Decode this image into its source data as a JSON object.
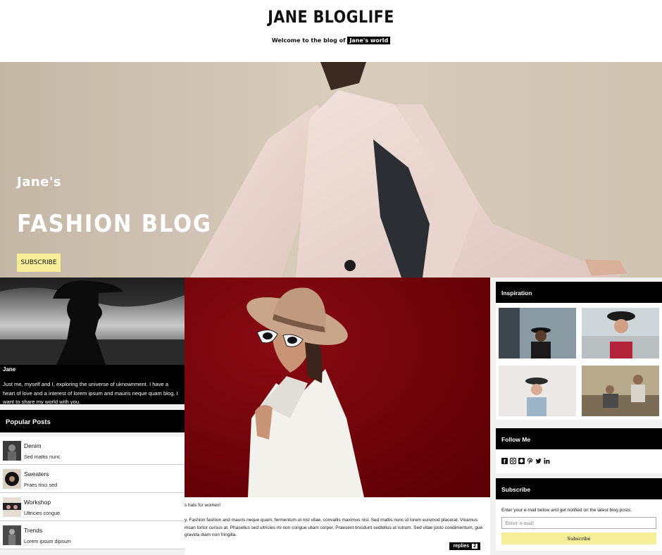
{
  "header": {
    "title": "JANE BLOGLIFE",
    "tagline_prefix": "Welcome to the blog of",
    "tagline_highlight": "Jane's world"
  },
  "hero": {
    "eyebrow": "Jane's",
    "title": "FASHION BLOG",
    "button_label": "SUBSCRIBE",
    "button_color": "#f7ee99"
  },
  "about": {
    "name": "Jane",
    "text": "Just me, myself and I, exploring the universe of uknownment. I have a heart of love and a interest of lorem ipsum and mauris neque quam blog. I want to share my world with you."
  },
  "popular_posts": {
    "heading": "Popular Posts",
    "items": [
      {
        "title": "Denim",
        "subtitle": "Sed mattis nunc"
      },
      {
        "title": "Sweaters",
        "subtitle": "Praes tinci sed"
      },
      {
        "title": "Workshop",
        "subtitle": "Ultricies congue"
      },
      {
        "title": "Trends",
        "subtitle": "Lorem ipsum dipsum"
      }
    ]
  },
  "main_post": {
    "title_fragment": "s hats for women!",
    "excerpt": "y. Fashion fashion and mauris neque quam, fermentum ut nisl vitae, convallis maximus nisl. Sed mattis nunc id lorem euismod placerat. Vivamus msan tortor cursus at. Phasellus sed ultricies mi non congue ullam corper. Praesent tincidunt sedtellus ut rutrum. Sed vitae justo condimentum, gue gravida diam non fringilla.",
    "replies_label": "replies",
    "replies_count": "2"
  },
  "sidebar": {
    "inspiration_heading": "Inspiration",
    "follow_heading": "Follow Me",
    "social_icons": [
      "facebook-icon",
      "instagram-icon",
      "snapchat-icon",
      "pinterest-icon",
      "twitter-icon",
      "linkedin-icon"
    ],
    "subscribe_heading": "Subscribe",
    "subscribe_text": "Enter your e-mail below and get notified on the latest blog posts.",
    "email_placeholder": "Enter e-mail",
    "subscribe_button": "Subscribe"
  },
  "colors": {
    "accent": "#f7ee99",
    "dark": "#000000",
    "feature_bg": "#740007"
  }
}
